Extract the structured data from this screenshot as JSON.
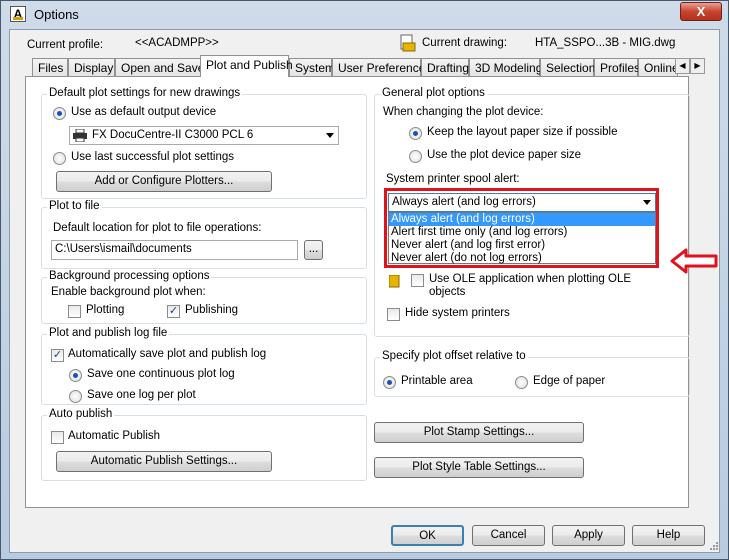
{
  "window": {
    "title": "Options",
    "close_label": "X"
  },
  "header": {
    "profile_label": "Current profile:",
    "profile_value": "<<ACADMPP>>",
    "drawing_label": "Current drawing:",
    "drawing_value": "HTA_SSPO...3B - MIG.dwg"
  },
  "tabs": [
    "Files",
    "Display",
    "Open and Save",
    "Plot and Publish",
    "System",
    "User Preferences",
    "Drafting",
    "3D Modeling",
    "Selection",
    "Profiles",
    "Online"
  ],
  "tab_scroll": {
    "left": "◀",
    "right": "▶"
  },
  "left": {
    "default_plot": {
      "title": "Default plot settings for new drawings",
      "use_default_label": "Use as default output device",
      "device_value": "FX DocuCentre-II C3000 PCL 6",
      "use_last_label": "Use last successful plot settings",
      "add_button": "Add or Configure Plotters..."
    },
    "plot_to_file": {
      "title": "Plot to file",
      "location_label": "Default location for plot to file operations:",
      "location_value": "C:\\Users\\ismail\\documents",
      "browse_button": "..."
    },
    "background": {
      "title": "Background processing options",
      "enable_label": "Enable background plot when:",
      "plotting_label": "Plotting",
      "publishing_label": "Publishing"
    },
    "log": {
      "title": "Plot and publish log file",
      "auto_save_label": "Automatically save plot and publish log",
      "continuous_label": "Save one continuous plot log",
      "per_plot_label": "Save one log per plot"
    },
    "auto_publish": {
      "title": "Auto publish",
      "checkbox_label": "Automatic Publish",
      "settings_button": "Automatic Publish Settings..."
    }
  },
  "right": {
    "general": {
      "title": "General plot options",
      "changing_label": "When changing the plot device:",
      "keep_layout_label": "Keep the layout paper size if possible",
      "use_device_label": "Use the plot device paper size",
      "spool_label": "System printer spool alert:",
      "spool_selected": "Always alert (and log errors)",
      "spool_options": [
        "Always alert (and log errors)",
        "Alert first time only (and log errors)",
        "Never alert (and log first error)",
        "Never alert (do not log errors)"
      ],
      "ole_label": "Use OLE application when plotting OLE objects",
      "hide_printers_label": "Hide system printers"
    },
    "offset": {
      "title": "Specify plot offset relative to",
      "printable_label": "Printable area",
      "edge_label": "Edge of paper"
    },
    "plot_stamp_button": "Plot Stamp Settings...",
    "plot_style_button": "Plot Style Table Settings..."
  },
  "footer": {
    "ok": "OK",
    "cancel": "Cancel",
    "apply": "Apply",
    "help": "Help"
  },
  "annotation": {
    "highlight_color": "#e0121c"
  }
}
